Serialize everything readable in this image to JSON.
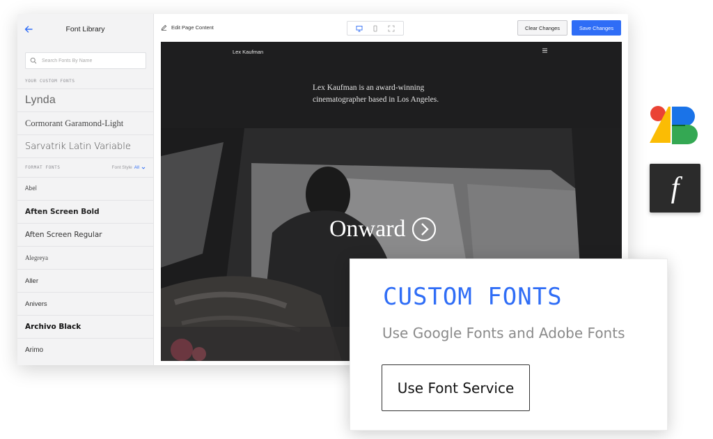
{
  "sidebar": {
    "title": "Font Library",
    "search_placeholder": "Search Fonts By Name",
    "custom_label": "Your Custom Fonts",
    "custom_fonts": [
      "Lynda",
      "Cormorant Garamond-Light",
      "Sarvatrik Latin Variable"
    ],
    "format_label": "Format Fonts",
    "font_style_label": "Font Style",
    "font_style_value": "All",
    "format_fonts": [
      "Abel",
      "Aften Screen Bold",
      "Aften Screen Regular",
      "Alegreya",
      "Aller",
      "Anivers",
      "Archivo Black",
      "Arimo"
    ]
  },
  "toolbar": {
    "edit_label": "Edit Page Content",
    "clear_label": "Clear Changes",
    "save_label": "Save Changes"
  },
  "preview": {
    "site_name": "Lex Kaufman",
    "hero_line1": "Lex Kaufman is an award-winning",
    "hero_line2": "cinematographer based in Los Angeles.",
    "cta": "Onward"
  },
  "callout": {
    "title": "CUSTOM FONTS",
    "subtitle": "Use Google Fonts and Adobe Fonts",
    "button": "Use Font Service"
  },
  "logos": {
    "adobe_glyph": "f"
  },
  "colors": {
    "accent": "#2f6df6",
    "sidebar_bg": "#f3f3f4",
    "preview_bg": "#1e1e1f"
  }
}
